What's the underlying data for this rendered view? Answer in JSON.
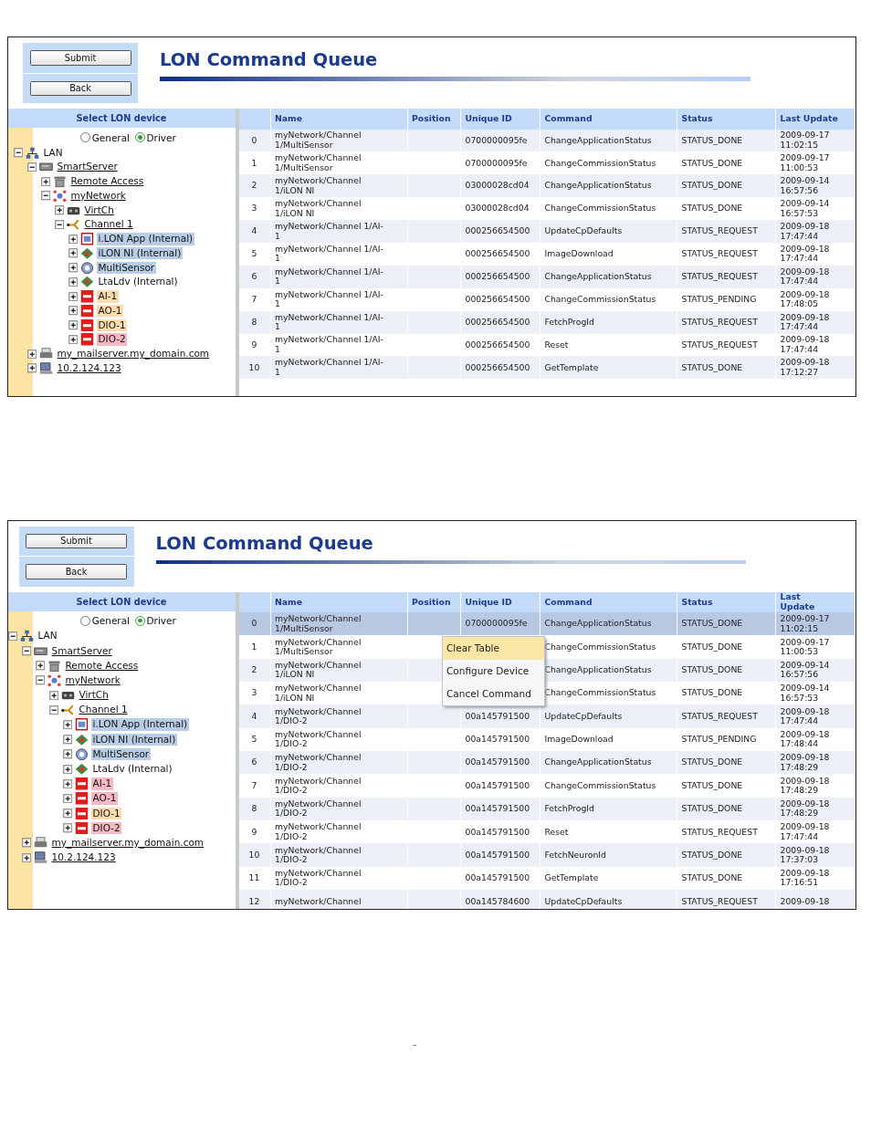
{
  "screens": [
    {
      "toolbar": {
        "buttons": [
          "Submit",
          "Back"
        ]
      },
      "title": "LON Command Queue",
      "device_panel": {
        "header": "Select LON device",
        "radios": [
          {
            "label": "General",
            "selected": false
          },
          {
            "label": "Driver",
            "selected": true
          }
        ],
        "tree": [
          {
            "label": "LAN",
            "kind": "network",
            "expanded": true,
            "underlined": false,
            "children": [
              {
                "label": "SmartServer",
                "kind": "server",
                "expanded": true,
                "underlined": true,
                "children": [
                  {
                    "label": "Remote Access",
                    "kind": "phone",
                    "expanded": false,
                    "underlined": true
                  },
                  {
                    "label": "myNetwork",
                    "kind": "mesh",
                    "expanded": true,
                    "underlined": true,
                    "children": [
                      {
                        "label": "VirtCh",
                        "kind": "router",
                        "expanded": false,
                        "underlined": true
                      },
                      {
                        "label": "Channel 1",
                        "kind": "channel",
                        "expanded": true,
                        "underlined": true,
                        "children": [
                          {
                            "label": "i.LON App (Internal)",
                            "kind": "app",
                            "expanded": false,
                            "underlined": false,
                            "color": "#b9cde5"
                          },
                          {
                            "label": "iLON NI (Internal)",
                            "kind": "chip",
                            "expanded": false,
                            "underlined": false,
                            "color": "#b9cde5"
                          },
                          {
                            "label": "MultiSensor",
                            "kind": "sensor",
                            "expanded": false,
                            "underlined": false,
                            "color": "#b9cde5"
                          },
                          {
                            "label": "LtaLdv (Internal)",
                            "kind": "chip",
                            "expanded": false,
                            "underlined": false
                          },
                          {
                            "label": "AI-1",
                            "kind": "device",
                            "expanded": false,
                            "underlined": false,
                            "color": "#fcdcae"
                          },
                          {
                            "label": "AO-1",
                            "kind": "device",
                            "expanded": false,
                            "underlined": false,
                            "color": "#fcdcae"
                          },
                          {
                            "label": "DIO-1",
                            "kind": "device",
                            "expanded": false,
                            "underlined": false,
                            "color": "#fcdcae"
                          },
                          {
                            "label": "DIO-2",
                            "kind": "device",
                            "expanded": false,
                            "underlined": false,
                            "color": "#f5b9c4"
                          }
                        ]
                      }
                    ]
                  }
                ]
              },
              {
                "label": "my_mailserver.my_domain.com",
                "kind": "printer",
                "expanded": false,
                "underlined": true
              },
              {
                "label": "10.2.124.123",
                "kind": "computer",
                "expanded": false,
                "underlined": true
              }
            ]
          }
        ]
      },
      "table": {
        "columns": [
          "",
          "Name",
          "Position",
          "Unique ID",
          "Command",
          "Status",
          "Last Update"
        ],
        "rows": [
          {
            "index": "0",
            "name": "myNetwork/Channel\n1/MultiSensor",
            "unique_id": "0700000095fe",
            "command": "ChangeApplicationStatus",
            "status": "STATUS_DONE",
            "last_update": "2009-09-17\n11:02:15",
            "selected": false
          },
          {
            "index": "1",
            "name": "myNetwork/Channel\n1/MultiSensor",
            "unique_id": "0700000095fe",
            "command": "ChangeCommissionStatus",
            "status": "STATUS_DONE",
            "last_update": "2009-09-17\n11:00:53",
            "selected": false
          },
          {
            "index": "2",
            "name": "myNetwork/Channel\n1/iLON NI",
            "unique_id": "03000028cd04",
            "command": "ChangeApplicationStatus",
            "status": "STATUS_DONE",
            "last_update": "2009-09-14\n16:57:56",
            "selected": false
          },
          {
            "index": "3",
            "name": "myNetwork/Channel\n1/iLON NI",
            "unique_id": "03000028cd04",
            "command": "ChangeCommissionStatus",
            "status": "STATUS_DONE",
            "last_update": "2009-09-14\n16:57:53",
            "selected": false
          },
          {
            "index": "4",
            "name": "myNetwork/Channel 1/AI-\n1",
            "unique_id": "000256654500",
            "command": "UpdateCpDefaults",
            "status": "STATUS_REQUEST",
            "last_update": "2009-09-18\n17:47:44",
            "selected": false
          },
          {
            "index": "5",
            "name": "myNetwork/Channel 1/AI-\n1",
            "unique_id": "000256654500",
            "command": "ImageDownload",
            "status": "STATUS_REQUEST",
            "last_update": "2009-09-18\n17:47:44",
            "selected": false
          },
          {
            "index": "6",
            "name": "myNetwork/Channel 1/AI-\n1",
            "unique_id": "000256654500",
            "command": "ChangeApplicationStatus",
            "status": "STATUS_REQUEST",
            "last_update": "2009-09-18\n17:47:44",
            "selected": false
          },
          {
            "index": "7",
            "name": "myNetwork/Channel 1/AI-\n1",
            "unique_id": "000256654500",
            "command": "ChangeCommissionStatus",
            "status": "STATUS_PENDING",
            "last_update": "2009-09-18\n17:48:05",
            "selected": false
          },
          {
            "index": "8",
            "name": "myNetwork/Channel 1/AI-\n1",
            "unique_id": "000256654500",
            "command": "FetchProgId",
            "status": "STATUS_REQUEST",
            "last_update": "2009-09-18\n17:47:44",
            "selected": false
          },
          {
            "index": "9",
            "name": "myNetwork/Channel 1/AI-\n1",
            "unique_id": "000256654500",
            "command": "Reset",
            "status": "STATUS_REQUEST",
            "last_update": "2009-09-18\n17:47:44",
            "selected": false
          },
          {
            "index": "10",
            "name": "myNetwork/Channel 1/AI-\n1",
            "unique_id": "000256654500",
            "command": "GetTemplate",
            "status": "STATUS_DONE",
            "last_update": "2009-09-18\n17:12:27",
            "selected": false
          }
        ]
      }
    },
    {
      "toolbar": {
        "buttons": [
          "Submit",
          "Back"
        ]
      },
      "title": "LON Command Queue",
      "device_panel": {
        "header": "Select LON device",
        "radios": [
          {
            "label": "General",
            "selected": false
          },
          {
            "label": "Driver",
            "selected": true
          }
        ],
        "tree": [
          {
            "label": "LAN",
            "kind": "network",
            "expanded": true,
            "underlined": false,
            "children": [
              {
                "label": "SmartServer",
                "kind": "server",
                "expanded": true,
                "underlined": true,
                "children": [
                  {
                    "label": "Remote Access",
                    "kind": "phone",
                    "expanded": false,
                    "underlined": true
                  },
                  {
                    "label": "myNetwork",
                    "kind": "mesh",
                    "expanded": true,
                    "underlined": true,
                    "children": [
                      {
                        "label": "VirtCh",
                        "kind": "router",
                        "expanded": false,
                        "underlined": true
                      },
                      {
                        "label": "Channel 1",
                        "kind": "channel",
                        "expanded": true,
                        "underlined": true,
                        "children": [
                          {
                            "label": "i.LON App (Internal)",
                            "kind": "app",
                            "expanded": false,
                            "underlined": false,
                            "color": "#b9cde5"
                          },
                          {
                            "label": "iLON NI (Internal)",
                            "kind": "chip",
                            "expanded": false,
                            "underlined": false,
                            "color": "#b9cde5"
                          },
                          {
                            "label": "MultiSensor",
                            "kind": "sensor",
                            "expanded": false,
                            "underlined": false,
                            "color": "#b9cde5"
                          },
                          {
                            "label": "LtaLdv (Internal)",
                            "kind": "chip",
                            "expanded": false,
                            "underlined": false
                          },
                          {
                            "label": "AI-1",
                            "kind": "device",
                            "expanded": false,
                            "underlined": false,
                            "color": "#f5b9c4"
                          },
                          {
                            "label": "AO-1",
                            "kind": "device",
                            "expanded": false,
                            "underlined": false,
                            "color": "#f5b9c4"
                          },
                          {
                            "label": "DIO-1",
                            "kind": "device",
                            "expanded": false,
                            "underlined": false,
                            "color": "#fcdcae"
                          },
                          {
                            "label": "DIO-2",
                            "kind": "device",
                            "expanded": false,
                            "underlined": false,
                            "color": "#f5b9c4"
                          }
                        ]
                      }
                    ]
                  }
                ]
              },
              {
                "label": "my_mailserver.my_domain.com",
                "kind": "printer",
                "expanded": false,
                "underlined": true
              },
              {
                "label": "10.2.124.123",
                "kind": "computer",
                "expanded": false,
                "underlined": true
              }
            ]
          }
        ]
      },
      "table": {
        "columns": [
          "",
          "Name",
          "Position",
          "Unique ID",
          "Command",
          "Status",
          "Last\nUpdate"
        ],
        "rows": [
          {
            "index": "0",
            "name": "myNetwork/Channel\n1/MultiSensor",
            "unique_id": "0700000095fe",
            "command": "ChangeApplicationStatus",
            "status": "STATUS_DONE",
            "last_update": "2009-09-17\n11:02:15",
            "selected": true
          },
          {
            "index": "1",
            "name": "myNetwork/Channel\n1/MultiSensor",
            "command": "ChangeCommissionStatus",
            "status": "STATUS_DONE",
            "last_update": "2009-09-17\n11:00:53",
            "selected": false
          },
          {
            "index": "2",
            "name": "myNetwork/Channel\n1/iLON NI",
            "command": "ChangeApplicationStatus",
            "status": "STATUS_DONE",
            "last_update": "2009-09-14\n16:57:56",
            "selected": false
          },
          {
            "index": "3",
            "name": "myNetwork/Channel\n1/iLON NI",
            "command": "ChangeCommissionStatus",
            "status": "STATUS_DONE",
            "last_update": "2009-09-14\n16:57:53",
            "selected": false
          },
          {
            "index": "4",
            "name": "myNetwork/Channel\n1/DIO-2",
            "unique_id": "00a145791500",
            "command": "UpdateCpDefaults",
            "status": "STATUS_REQUEST",
            "last_update": "2009-09-18\n17:47:44",
            "selected": false
          },
          {
            "index": "5",
            "name": "myNetwork/Channel\n1/DIO-2",
            "unique_id": "00a145791500",
            "command": "ImageDownload",
            "status": "STATUS_PENDING",
            "last_update": "2009-09-18\n17:48:44",
            "selected": false
          },
          {
            "index": "6",
            "name": "myNetwork/Channel\n1/DIO-2",
            "unique_id": "00a145791500",
            "command": "ChangeApplicationStatus",
            "status": "STATUS_DONE",
            "last_update": "2009-09-18\n17:48:29",
            "selected": false
          },
          {
            "index": "7",
            "name": "myNetwork/Channel\n1/DIO-2",
            "unique_id": "00a145791500",
            "command": "ChangeCommissionStatus",
            "status": "STATUS_DONE",
            "last_update": "2009-09-18\n17:48:29",
            "selected": false
          },
          {
            "index": "8",
            "name": "myNetwork/Channel\n1/DIO-2",
            "unique_id": "00a145791500",
            "command": "FetchProgId",
            "status": "STATUS_DONE",
            "last_update": "2009-09-18\n17:48:29",
            "selected": false
          },
          {
            "index": "9",
            "name": "myNetwork/Channel\n1/DIO-2",
            "unique_id": "00a145791500",
            "command": "Reset",
            "status": "STATUS_REQUEST",
            "last_update": "2009-09-18\n17:47:44",
            "selected": false
          },
          {
            "index": "10",
            "name": "myNetwork/Channel\n1/DIO-2",
            "unique_id": "00a145791500",
            "command": "FetchNeuronId",
            "status": "STATUS_DONE",
            "last_update": "2009-09-18\n17:37:03",
            "selected": false
          },
          {
            "index": "11",
            "name": "myNetwork/Channel\n1/DIO-2",
            "unique_id": "00a145791500",
            "command": "GetTemplate",
            "status": "STATUS_DONE",
            "last_update": "2009-09-18\n17:16:51",
            "selected": false
          },
          {
            "index": "12",
            "name": "myNetwork/Channel",
            "unique_id": "00a145784600",
            "command": "UpdateCpDefaults",
            "status": "STATUS_REQUEST",
            "last_update": "2009-09-18",
            "selected": false
          }
        ]
      },
      "context_menu": {
        "items": [
          {
            "label": "Clear Table",
            "selected": true
          },
          {
            "label": "Configure Device",
            "selected": false
          },
          {
            "label": "Cancel Command",
            "selected": false
          }
        ]
      }
    }
  ],
  "page_mark": "–"
}
